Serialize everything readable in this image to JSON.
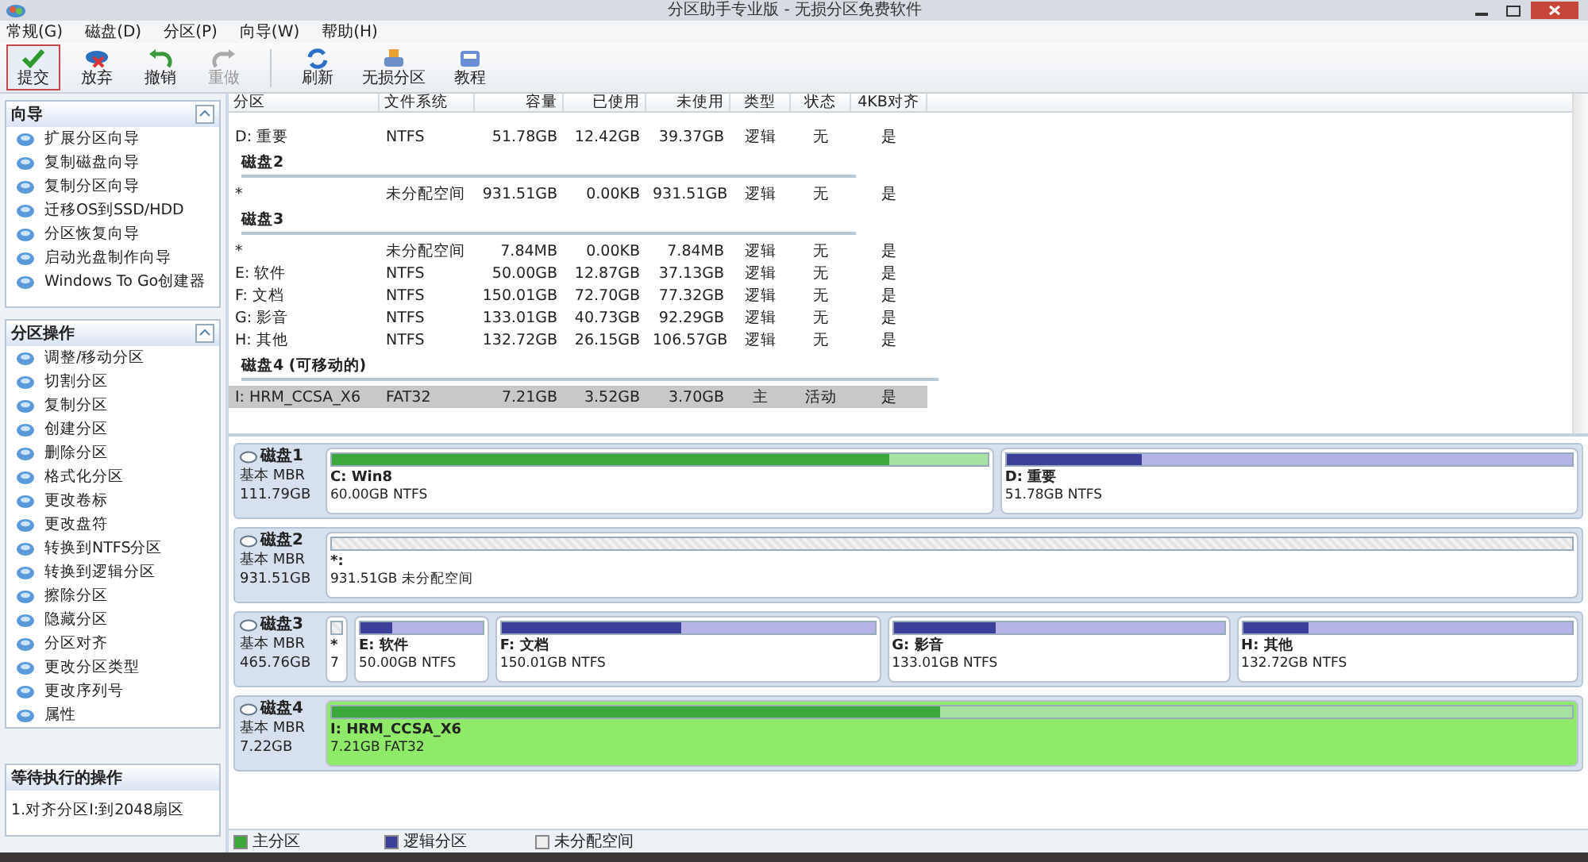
{
  "window": {
    "title": "分区助手专业版 - 无损分区免费软件"
  },
  "menu": [
    "常规(G)",
    "磁盘(D)",
    "分区(P)",
    "向导(W)",
    "帮助(H)"
  ],
  "toolbar": [
    [
      {
        "kind": "check",
        "label": "提交",
        "selected": true,
        "disabled": false
      },
      {
        "kind": "discard",
        "label": "放弃",
        "selected": false,
        "disabled": false
      },
      {
        "kind": "undo",
        "label": "撤销",
        "selected": false,
        "disabled": false
      },
      {
        "kind": "redo",
        "label": "重做",
        "selected": false,
        "disabled": true
      }
    ],
    [
      {
        "kind": "refresh",
        "label": "刷新",
        "selected": false,
        "disabled": false
      },
      {
        "kind": "partition",
        "label": "无损分区",
        "selected": false,
        "disabled": false
      },
      {
        "kind": "tutorial",
        "label": "教程",
        "selected": false,
        "disabled": false
      }
    ]
  ],
  "panels": [
    {
      "title": "向导",
      "items": [
        "扩展分区向导",
        "复制磁盘向导",
        "复制分区向导",
        "迁移OS到SSD/HDD",
        "分区恢复向导",
        "启动光盘制作向导",
        "Windows To Go创建器"
      ]
    },
    {
      "title": "分区操作",
      "items": [
        "调整/移动分区",
        "切割分区",
        "复制分区",
        "创建分区",
        "删除分区",
        "格式化分区",
        "更改卷标",
        "更改盘符",
        "转换到NTFS分区",
        "转换到逻辑分区",
        "擦除分区",
        "隐藏分区",
        "分区对齐",
        "更改分区类型",
        "更改序列号",
        "属性"
      ]
    }
  ],
  "pending_panel": {
    "title": "等待执行的操作",
    "items": [
      "1.对齐分区I:到2048扇区"
    ]
  },
  "table": {
    "columns": [
      "分区",
      "文件系统",
      "容量",
      "已使用",
      "未使用",
      "类型",
      "状态",
      "4KB对齐"
    ],
    "rows": [
      {
        "kind": "partition",
        "selected": false,
        "cells": [
          "D: 重要",
          "NTFS",
          "51.78GB",
          "12.42GB",
          "39.37GB",
          "逻辑",
          "无",
          "是"
        ]
      },
      {
        "kind": "disk",
        "label": "磁盘2"
      },
      {
        "kind": "partition",
        "selected": false,
        "cells": [
          "*",
          "未分配空间",
          "931.51GB",
          "0.00KB",
          "931.51GB",
          "逻辑",
          "无",
          "是"
        ]
      },
      {
        "kind": "disk",
        "label": "磁盘3"
      },
      {
        "kind": "partition",
        "selected": false,
        "cells": [
          "*",
          "未分配空间",
          "7.84MB",
          "0.00KB",
          "7.84MB",
          "逻辑",
          "无",
          "是"
        ]
      },
      {
        "kind": "partition",
        "selected": false,
        "cells": [
          "E: 软件",
          "NTFS",
          "50.00GB",
          "12.87GB",
          "37.13GB",
          "逻辑",
          "无",
          "是"
        ]
      },
      {
        "kind": "partition",
        "selected": false,
        "cells": [
          "F: 文档",
          "NTFS",
          "150.01GB",
          "72.70GB",
          "77.32GB",
          "逻辑",
          "无",
          "是"
        ]
      },
      {
        "kind": "partition",
        "selected": false,
        "cells": [
          "G: 影音",
          "NTFS",
          "133.01GB",
          "40.73GB",
          "92.29GB",
          "逻辑",
          "无",
          "是"
        ]
      },
      {
        "kind": "partition",
        "selected": false,
        "cells": [
          "H: 其他",
          "NTFS",
          "132.72GB",
          "26.15GB",
          "106.57GB",
          "逻辑",
          "无",
          "是"
        ]
      },
      {
        "kind": "disk",
        "label": "磁盘4 (可移动的)"
      },
      {
        "kind": "partition",
        "selected": true,
        "cells": [
          "I: HRM_CCSA_X6",
          "FAT32",
          "7.21GB",
          "3.52GB",
          "3.70GB",
          "主",
          "活动",
          "是"
        ]
      }
    ]
  },
  "disk_map": [
    {
      "name": "磁盘1",
      "type": "基本 MBR",
      "size": "111.79GB",
      "partitions": [
        {
          "kind": "primary",
          "label": "C: Win8",
          "info": "60.00GB NTFS",
          "level": 0.85,
          "selected": false
        },
        {
          "kind": "logical",
          "label": "D: 重要",
          "info": "51.78GB NTFS",
          "level": 0.24,
          "selected": false
        }
      ]
    },
    {
      "name": "磁盘2",
      "type": "基本 MBR",
      "size": "931.51GB",
      "partitions": [
        {
          "kind": "unallocated",
          "label": "*:",
          "info": "931.51GB 未分配空间",
          "selected": false
        }
      ]
    },
    {
      "name": "磁盘3",
      "type": "基本 MBR",
      "size": "465.76GB",
      "partitions": [
        {
          "kind": "unallocated",
          "label": "*",
          "info": "7",
          "selected": false
        },
        {
          "kind": "logical",
          "label": "E: 软件",
          "info": "50.00GB NTFS",
          "level": 0.26,
          "selected": false
        },
        {
          "kind": "logical",
          "label": "F: 文档",
          "info": "150.01GB NTFS",
          "level": 0.48,
          "selected": false
        },
        {
          "kind": "logical",
          "label": "G: 影音",
          "info": "133.01GB NTFS",
          "level": 0.31,
          "selected": false
        },
        {
          "kind": "logical",
          "label": "H: 其他",
          "info": "132.72GB NTFS",
          "level": 0.2,
          "selected": false
        }
      ]
    },
    {
      "name": "磁盘4",
      "type": "基本 MBR",
      "size": "7.22GB",
      "partitions": [
        {
          "kind": "primary",
          "label": "I: HRM_CCSA_X6",
          "info": "7.21GB FAT32",
          "level": 0.49,
          "selected": true
        }
      ]
    }
  ],
  "legend": [
    {
      "kind": "primary",
      "label": "主分区"
    },
    {
      "kind": "logical",
      "label": "逻辑分区"
    },
    {
      "kind": "unallocated",
      "label": "未分配空间"
    }
  ]
}
